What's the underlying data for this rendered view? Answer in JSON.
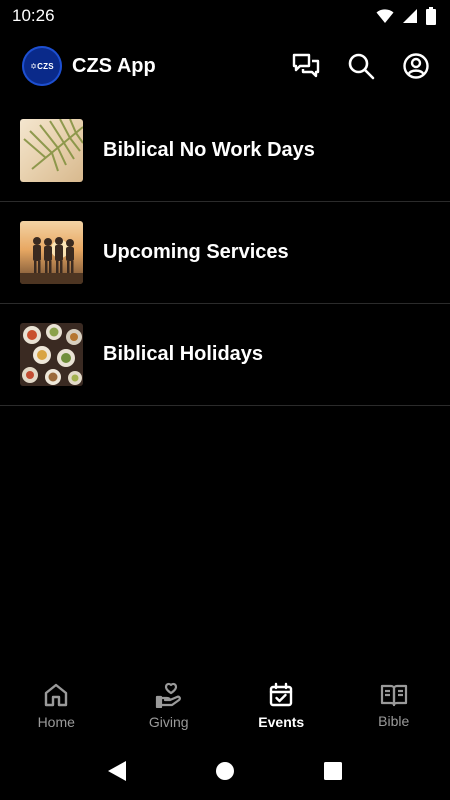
{
  "status_bar": {
    "time": "10:26"
  },
  "header": {
    "logo_text": "✡CZS",
    "title": "CZS App",
    "actions": [
      "chat-icon",
      "search-icon",
      "account-icon"
    ]
  },
  "events": [
    {
      "label": "Biblical No Work Days",
      "thumbnail": "palm-leaf-image"
    },
    {
      "label": "Upcoming Services",
      "thumbnail": "people-sunset-image"
    },
    {
      "label": "Biblical Holidays",
      "thumbnail": "food-table-image"
    }
  ],
  "bottom_nav": [
    {
      "label": "Home",
      "icon": "home-icon",
      "active": false
    },
    {
      "label": "Giving",
      "icon": "giving-hand-icon",
      "active": false
    },
    {
      "label": "Events",
      "icon": "calendar-check-icon",
      "active": true
    },
    {
      "label": "Bible",
      "icon": "book-icon",
      "active": false
    }
  ],
  "colors": {
    "background": "#000000",
    "active_nav": "#ffffff",
    "inactive_nav": "#9a9a9a",
    "logo": "#0a2a8a"
  }
}
